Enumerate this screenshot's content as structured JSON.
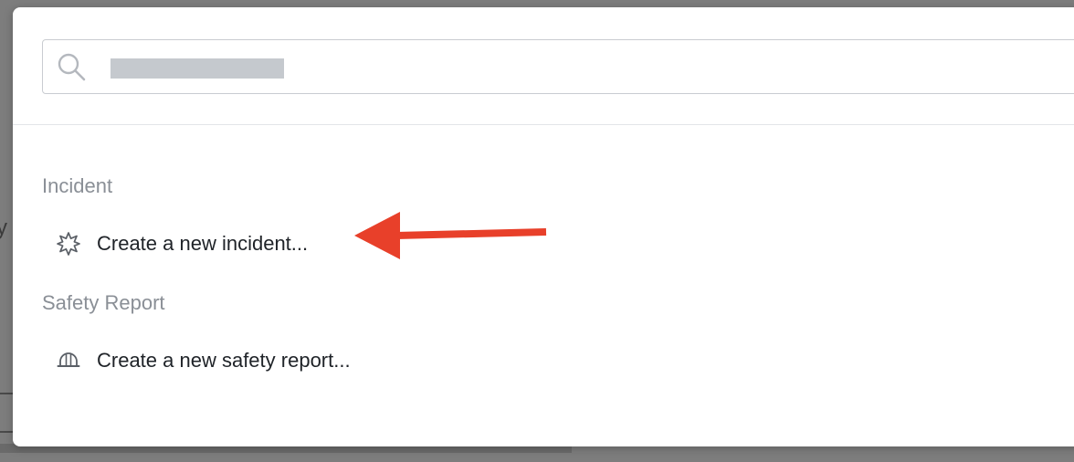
{
  "search": {
    "value": "",
    "placeholder": ""
  },
  "groups": [
    {
      "heading": "Incident",
      "items": [
        {
          "label": "Create a new incident...",
          "icon": "incident-burst-icon"
        }
      ]
    },
    {
      "heading": "Safety Report",
      "items": [
        {
          "label": "Create a new safety report...",
          "icon": "hard-hat-icon"
        }
      ]
    }
  ],
  "annotation": {
    "type": "arrow",
    "color": "#e8402a",
    "points_to": "Create a new incident..."
  },
  "colors": {
    "overlay": "#7d7d7d",
    "modal_bg": "#ffffff",
    "heading_text": "#8a8f96",
    "item_text": "#1f2328",
    "redaction": "#c5c9ce"
  }
}
